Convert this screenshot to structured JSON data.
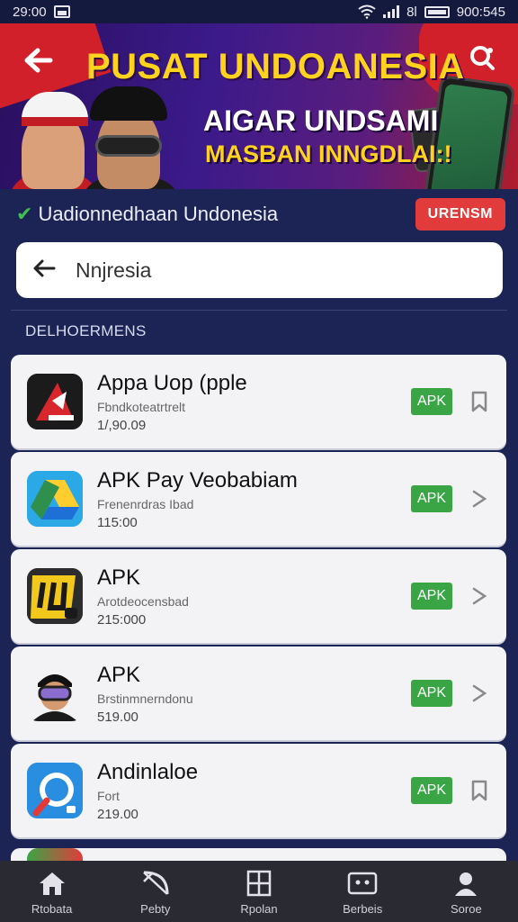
{
  "status_bar": {
    "time_left": "29:00",
    "sim_label": "8l",
    "time_right": "900:545"
  },
  "banner": {
    "title": "PUSAT UNDOANESIA",
    "subtitle1": "AIGAR UNDSAMI",
    "subtitle2": "MASBAN INNGDLAI:!",
    "back_icon": "arrow-left-icon",
    "share_icon": "share-icon"
  },
  "verified": {
    "text": "Uadionnedhaan  Undonesia",
    "badge_label": "URENSM"
  },
  "search": {
    "value": "Nnjresia",
    "back_icon": "arrow-left-icon"
  },
  "section": {
    "title": "DELHOERMENS"
  },
  "apps": [
    {
      "name": "Appa Uop (pple",
      "desc": "Fbndkoteatrtrelt",
      "size": "1/,90.09",
      "badge": "APK",
      "action": "bookmark-icon",
      "icon": "red-black-app-icon"
    },
    {
      "name": "APK  Pay Veobabiam",
      "desc": "Frenenrdras Ibad",
      "size": "115:00",
      "badge": "APK",
      "action": "chevron-right-icon",
      "icon": "drive-triangle-icon"
    },
    {
      "name": "APK",
      "desc": "Arotdeocensbad",
      "size": "215:000",
      "badge": "APK",
      "action": "chevron-right-icon",
      "icon": "yellow-game-icon"
    },
    {
      "name": "APK",
      "desc": "Brstinmnerndonu",
      "size": "519.00",
      "badge": "APK",
      "action": "chevron-right-icon",
      "icon": "avatar-goggles-icon"
    },
    {
      "name": "Andinlaloe",
      "desc": "Fort",
      "size": "219.00",
      "badge": "APK",
      "action": "bookmark-icon",
      "icon": "blue-compass-icon"
    }
  ],
  "nav": [
    {
      "label": "Rtobata",
      "icon": "home-icon"
    },
    {
      "label": "Pebty",
      "icon": "bow-icon"
    },
    {
      "label": "Rpolan",
      "icon": "grid-icon"
    },
    {
      "label": "Berbeis",
      "icon": "media-icon"
    },
    {
      "label": "Soroe",
      "icon": "person-icon"
    }
  ]
}
